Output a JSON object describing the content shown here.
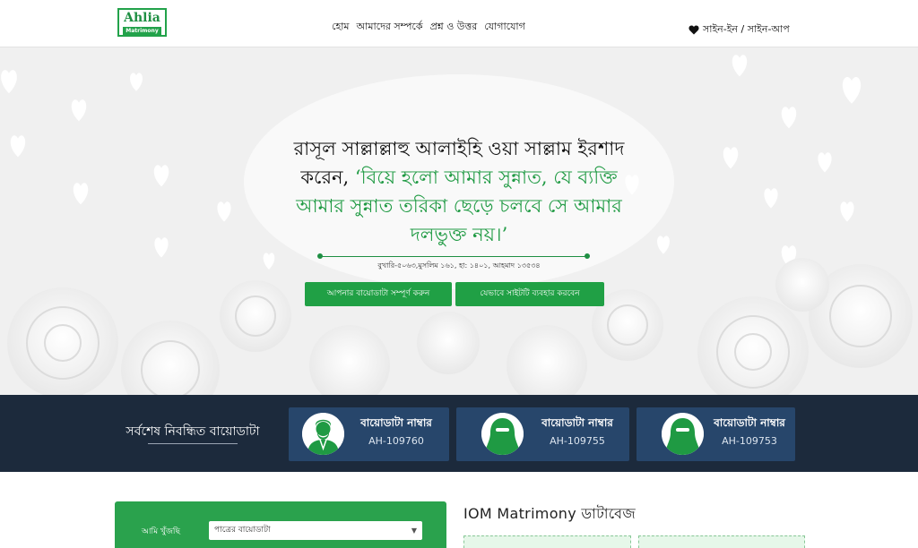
{
  "header": {
    "logo": {
      "main": "Ahlia",
      "sub": "Matrimony"
    },
    "nav": [
      "হোম",
      "আমাদের সম্পর্কে",
      "প্রশ্ন ও উত্তর",
      "যোগাযোগ"
    ],
    "auth_label": "সাইন-ইন / সাইন-আপ"
  },
  "hero": {
    "quote_intro": "রাসূল সাল্লাল্লাহু আলাইহি ওয়া সাল্লাম ইরশাদ করেন,",
    "quote_green": "‘বিয়ে হলো আমার সুন্নাত, যে ব্যক্তি আমার সুন্নাত তরিকা ছেড়ে চলবে সে আমার দলভুক্ত নয়।’",
    "reference": "বুখারি-৫০৬৩,মুসলিম ১৬১, হা: ১৪০১, আহমাদ ১৩৫৩৪",
    "buttons": [
      "আপনার বায়োডাটা সম্পূর্ণ করুন",
      "যেভাবে সাইটটি ব্যবহার করবেন"
    ]
  },
  "recent": {
    "title": "সর্বশেষ নিবন্ধিত বায়োডাটা",
    "cards": [
      {
        "title": "বায়োডাটা নাম্বার",
        "id": "AH-109760",
        "avatar": "male-avatar-icon"
      },
      {
        "title": "বায়োডাটা নাম্বার",
        "id": "AH-109755",
        "avatar": "female-avatar-icon"
      },
      {
        "title": "বায়োডাটা নাম্বার",
        "id": "AH-109753",
        "avatar": "female-avatar-icon"
      }
    ]
  },
  "search": {
    "label": "আমি খুঁজছি",
    "selected": "পাত্রের বায়োডাটা"
  },
  "database": {
    "title": "IOM Matrimony ডাটাবেজ"
  },
  "colors": {
    "green": "#20a045",
    "navy": "#1c2a3c",
    "card": "#27466b"
  }
}
